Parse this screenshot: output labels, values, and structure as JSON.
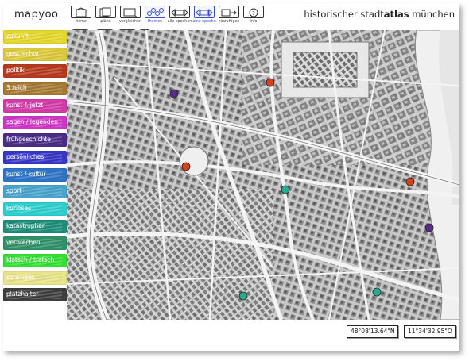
{
  "app": {
    "logo": "mapyoo",
    "title_prefix": "historischer stadt",
    "title_bold": "atlas",
    "title_suffix": " münchen"
  },
  "toolbar": [
    {
      "label": "home",
      "icon": "home-icon"
    },
    {
      "label": "pläne",
      "icon": "plans-icon"
    },
    {
      "label": "vergleichen",
      "icon": "compare-icon"
    },
    {
      "label": "themen",
      "icon": "themes-icon"
    },
    {
      "label": "alle epochen",
      "icon": "all-epochs-icon"
    },
    {
      "label": "eine epoche",
      "icon": "one-epoch-icon"
    },
    {
      "label": "hinzufügen",
      "icon": "add-icon"
    },
    {
      "label": "info",
      "icon": "info-icon"
    }
  ],
  "zoom": [
    {
      "icon": "zoom-in-icon"
    },
    {
      "icon": "zoom-out-icon"
    },
    {
      "icon": "pan-icon"
    },
    {
      "icon": "reset-icon"
    }
  ],
  "categories": [
    {
      "label": "zukunft",
      "color": "#e6d82a"
    },
    {
      "label": "geschichte",
      "color": "#dcc93a"
    },
    {
      "label": "politik",
      "color": "#b73a1e"
    },
    {
      "label": "3.reich",
      "color": "#a77a33"
    },
    {
      "label": "kunst f. jetzt",
      "color": "#d23aa6"
    },
    {
      "label": "sagen / legenden",
      "color": "#cf35c6"
    },
    {
      "label": "frühgeschichte",
      "color": "#4a2c86"
    },
    {
      "label": "persönliches",
      "color": "#3636c8"
    },
    {
      "label": "kunst / kultur",
      "color": "#2d74c6"
    },
    {
      "label": "sport",
      "color": "#48a4cc"
    },
    {
      "label": "kurioses",
      "color": "#2cd0d0"
    },
    {
      "label": "katastrophen",
      "color": "#1e8e7a"
    },
    {
      "label": "verbrechen",
      "color": "#2f9168"
    },
    {
      "label": "klatsch / tratsch",
      "color": "#34e034"
    },
    {
      "label": "sonstiges",
      "color": "#e8e488"
    },
    {
      "label": "platzhalter",
      "color": "#3e3e3e"
    }
  ],
  "markers": [
    {
      "category": "frühgeschichte",
      "color": "#5a2a8a"
    },
    {
      "category": "politik",
      "color": "#d8401a"
    },
    {
      "category": "politik",
      "color": "#d8401a"
    },
    {
      "category": "politik",
      "color": "#d8401a"
    },
    {
      "category": "katastrophen",
      "color": "#2aa890"
    },
    {
      "category": "frühgeschichte",
      "color": "#5a2a8a"
    },
    {
      "category": "katastrophen",
      "color": "#2aa890"
    },
    {
      "category": "katastrophen",
      "color": "#2aa890"
    }
  ],
  "coords": {
    "lat": "48°08'13.64\"N",
    "lon": "11°34'32.95\"O"
  }
}
